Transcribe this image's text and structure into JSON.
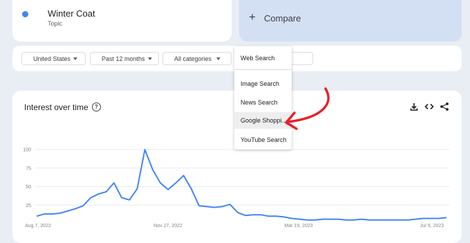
{
  "term": {
    "name": "Winter Coat",
    "type": "Topic",
    "dot_color": "#4285f4"
  },
  "compare": {
    "plus": "+",
    "label": "Compare"
  },
  "filters": {
    "region": "United States",
    "time": "Past 12 months",
    "category": "All categories"
  },
  "panel": {
    "title": "Interest over time",
    "help_icon": "?",
    "tools": [
      "download-icon",
      "embed-icon",
      "share-icon"
    ]
  },
  "search_type_menu": {
    "items": [
      "Web Search",
      "Image Search",
      "News Search",
      "Google Shoppi...",
      "YouTube Search"
    ],
    "highlighted": "Google Shoppi..."
  },
  "chart_data": {
    "type": "line",
    "title": "Interest over time",
    "y_ticks": [
      "100",
      "75",
      "50",
      "25"
    ],
    "x_ticks": [
      "Aug 7, 2022",
      "Nov 27, 2022",
      "Mar 19, 2023",
      "Jul 9, 2023"
    ],
    "ylim": [
      0,
      100
    ],
    "grid": true,
    "series": [
      {
        "color": "#4285f4",
        "values": [
          10,
          13,
          13,
          14,
          17,
          20,
          24,
          35,
          40,
          43,
          55,
          35,
          32,
          47,
          100,
          73,
          55,
          46,
          55,
          65,
          47,
          24,
          23,
          22,
          23,
          26,
          15,
          11,
          12,
          12,
          10,
          10,
          9,
          7,
          6,
          5,
          5,
          6,
          6,
          6,
          5,
          5,
          6,
          5,
          5,
          5,
          5,
          5,
          5,
          6,
          7,
          7,
          7,
          8
        ]
      }
    ]
  },
  "annotation": {
    "arrow_color": "#e8202a"
  }
}
